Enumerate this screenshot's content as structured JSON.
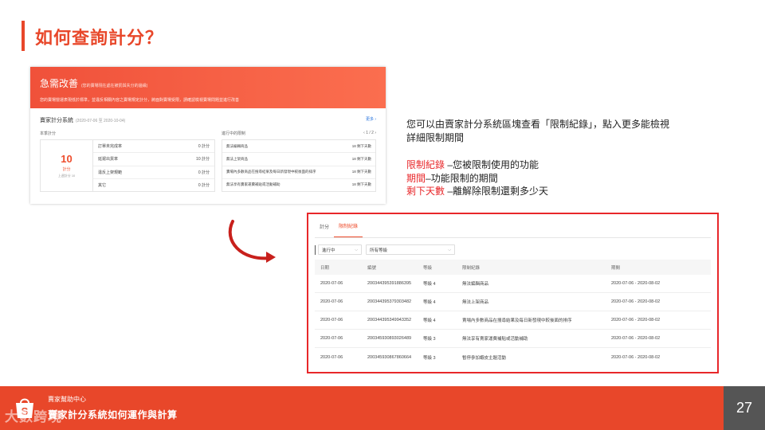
{
  "slide": {
    "title": "如何查詢計分？",
    "page_number": "27"
  },
  "panel_top": {
    "banner_title": "急需改善",
    "banner_title_note": "(您的賣場現在處在被罰與失分的邊緣)",
    "banner_subtitle": "您的賣場營運表現低於標準，並違反相關內容之賣場規定計分，將面對賣場受限，請確認檢視賣場問題並進行改善",
    "section_title": "賣家計分系統",
    "section_period": "(2020-07-06 至 2020-10-04)",
    "more_link": "更多 ›",
    "current_points_label": "本季計分",
    "restrictions_label": "進行中的限制",
    "pager": "‹  1 / 2  ›",
    "score_value": "10",
    "score_unit": "計分",
    "score_prev": "上週計分 10",
    "score_items": [
      {
        "label": "訂單未完成率",
        "points": "0 計分"
      },
      {
        "label": "延遲出貨率",
        "points": "10 計分"
      },
      {
        "label": "違反上架規範",
        "points": "0 計分"
      },
      {
        "label": "其它",
        "points": "0 計分"
      }
    ],
    "restrictions": [
      {
        "label": "無法編輯商品",
        "days": "18 剩下天數"
      },
      {
        "label": "無法上架商品",
        "days": "18 剩下天數"
      },
      {
        "label": "賣場內多數商品在搜尋結果及每日新發現中較後面的排序",
        "days": "18 剩下天數"
      },
      {
        "label": "無法享有賣家運費補貼或活動補助",
        "days": "18 剩下天數"
      }
    ]
  },
  "description": {
    "line1": "您可以由賣家計分系統區塊查看「限制紀錄」，點入更多能檢視",
    "line2": "詳細限制期間",
    "definitions": [
      {
        "term": "限制紀錄",
        "text": " –您被限制使用的功能"
      },
      {
        "term": "期間",
        "text": "–功能限制的期間"
      },
      {
        "term": "剩下天數",
        "text": " –離解除限制還剩多少天"
      }
    ]
  },
  "panel_bottom": {
    "tabs": [
      "計分",
      "限制紀錄"
    ],
    "active_tab": 1,
    "filter_status": "進行中",
    "filter_level": "所有等級",
    "columns": [
      "日期",
      "編號",
      "等級",
      "限制紀錄",
      "期間"
    ],
    "rows": [
      {
        "date": "2020-07-06",
        "id": "200344395391886395",
        "level": "等級 4",
        "record": "無法編輯商品",
        "period": "2020-07-06 - 2020-08-02"
      },
      {
        "date": "2020-07-06",
        "id": "200344395379303482",
        "level": "等級 4",
        "record": "無法上架商品",
        "period": "2020-07-06 - 2020-08-02"
      },
      {
        "date": "2020-07-06",
        "id": "200344395349943352",
        "level": "等級 4",
        "record": "賣場內多數商品在搜尋結果及每日新發現中較後面的排序",
        "period": "2020-07-06 - 2020-08-02"
      },
      {
        "date": "2020-07-06",
        "id": "200345930893026489",
        "level": "等級 3",
        "record": "無法享有賣家運費補貼或活動補助",
        "period": "2020-07-06 - 2020-08-02"
      },
      {
        "date": "2020-07-06",
        "id": "200345930867860664",
        "level": "等級 3",
        "record": "暫停參加蝦皮主題活動",
        "period": "2020-07-06 - 2020-08-02"
      }
    ]
  },
  "footer": {
    "subtitle": "賣家幫助中心",
    "title": "賣家計分系統如何運作與計算",
    "watermark": "大數跨境"
  },
  "colors": {
    "accent": "#e8472a",
    "highlight_red": "#e8272a",
    "page_number_bg": "#555555"
  }
}
